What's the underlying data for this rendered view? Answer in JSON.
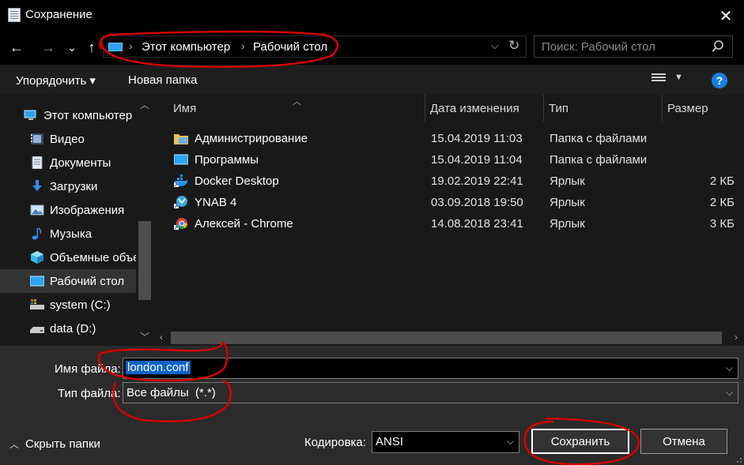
{
  "window": {
    "title": "Сохранение",
    "close_glyph": "✕"
  },
  "nav": {
    "back_glyph": "←",
    "forward_glyph": "→",
    "recent_glyph": "⌄",
    "up_glyph": "↑",
    "breadcrumb": [
      "Этот компьютер",
      "Рабочий стол"
    ],
    "crumb_sep": "›",
    "search_placeholder": "Поиск: Рабочий стол"
  },
  "toolbar": {
    "organize_label": "Упорядочить ▾",
    "new_folder_label": "Новая папка",
    "help_glyph": "?"
  },
  "sidebar": {
    "items": [
      {
        "label": "Этот компьютер",
        "icon": "computer-icon"
      },
      {
        "label": "Видео",
        "icon": "video-icon"
      },
      {
        "label": "Документы",
        "icon": "documents-icon"
      },
      {
        "label": "Загрузки",
        "icon": "downloads-icon"
      },
      {
        "label": "Изображения",
        "icon": "pictures-icon"
      },
      {
        "label": "Музыка",
        "icon": "music-icon"
      },
      {
        "label": "Объемные объекты",
        "icon": "3d-objects-icon"
      },
      {
        "label": "Рабочий стол",
        "icon": "desktop-icon",
        "selected": true
      },
      {
        "label": "system (C:)",
        "icon": "drive-c-icon"
      },
      {
        "label": "data (D:)",
        "icon": "drive-d-icon"
      }
    ]
  },
  "files": {
    "columns": [
      "Имя",
      "Дата изменения",
      "Тип",
      "Размер"
    ],
    "rows": [
      {
        "name": "Администрирование",
        "date": "15.04.2019 11:03",
        "type": "Папка с файлами",
        "size": "",
        "icon": "folder-admin-icon"
      },
      {
        "name": "Программы",
        "date": "15.04.2019 11:04",
        "type": "Папка с файлами",
        "size": "",
        "icon": "folder-programs-icon"
      },
      {
        "name": "Docker Desktop",
        "date": "19.02.2019 22:41",
        "type": "Ярлык",
        "size": "2 КБ",
        "icon": "docker-shortcut-icon"
      },
      {
        "name": "YNAB 4",
        "date": "03.09.2018 19:50",
        "type": "Ярлык",
        "size": "2 КБ",
        "icon": "ynab-shortcut-icon"
      },
      {
        "name": "Алексей - Chrome",
        "date": "14.08.2018 23:41",
        "type": "Ярлык",
        "size": "3 КБ",
        "icon": "chrome-shortcut-icon"
      }
    ]
  },
  "form": {
    "filename_label": "Имя файла:",
    "filename_value": "london.conf",
    "filetype_label": "Тип файла:",
    "filetype_value": "Все файлы  (*.*)",
    "encoding_label": "Кодировка:",
    "encoding_value": "ANSI",
    "save_label": "Сохранить",
    "cancel_label": "Отмена",
    "hide_folders_label": "Скрыть папки"
  },
  "colors": {
    "accent": "#0a64c8",
    "annotation_red": "#d40000",
    "background": "#1e1e1e"
  }
}
